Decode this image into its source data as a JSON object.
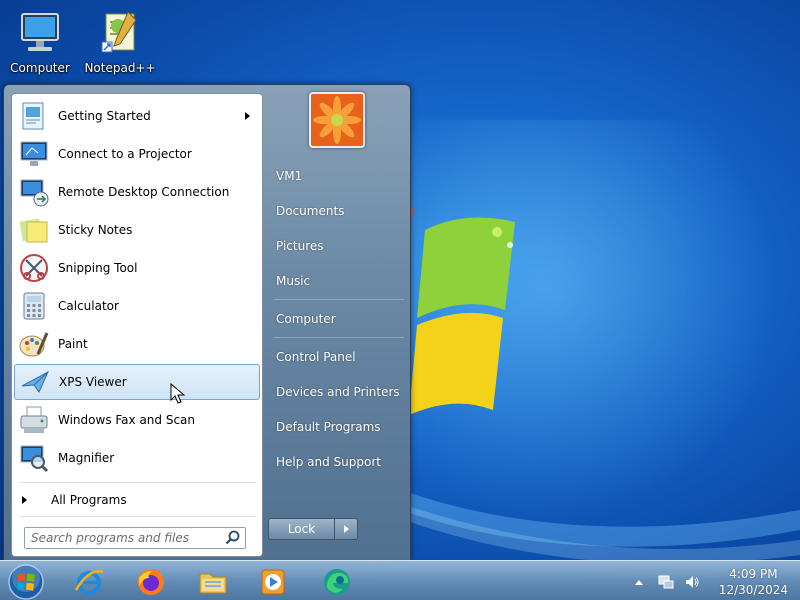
{
  "desktop": {
    "icons": [
      {
        "label": "Computer",
        "icon": "computer-icon"
      },
      {
        "label": "Notepad++",
        "icon": "notepad-plus-plus-icon"
      }
    ]
  },
  "start_menu": {
    "programs": [
      {
        "label": "Getting Started",
        "icon": "getting-started-icon",
        "has_submenu": true
      },
      {
        "label": "Connect to a Projector",
        "icon": "projector-icon"
      },
      {
        "label": "Remote Desktop Connection",
        "icon": "remote-desktop-icon"
      },
      {
        "label": "Sticky Notes",
        "icon": "sticky-notes-icon"
      },
      {
        "label": "Snipping Tool",
        "icon": "snipping-tool-icon"
      },
      {
        "label": "Calculator",
        "icon": "calculator-icon"
      },
      {
        "label": "Paint",
        "icon": "paint-icon"
      },
      {
        "label": "XPS Viewer",
        "icon": "xps-viewer-icon",
        "highlighted": true
      },
      {
        "label": "Windows Fax and Scan",
        "icon": "fax-scan-icon"
      },
      {
        "label": "Magnifier",
        "icon": "magnifier-icon"
      }
    ],
    "all_programs_label": "All Programs",
    "search_placeholder": "Search programs and files",
    "right_items": [
      {
        "label": "VM1"
      },
      {
        "label": "Documents"
      },
      {
        "label": "Pictures"
      },
      {
        "label": "Music"
      },
      {
        "label": "Computer"
      },
      {
        "label": "Control Panel"
      },
      {
        "label": "Devices and Printers"
      },
      {
        "label": "Default Programs"
      },
      {
        "label": "Help and Support"
      }
    ],
    "shutdown_label": "Lock"
  },
  "taskbar": {
    "pinned": [
      {
        "icon": "internet-explorer-icon"
      },
      {
        "icon": "firefox-icon"
      },
      {
        "icon": "file-explorer-icon"
      },
      {
        "icon": "media-player-icon"
      },
      {
        "icon": "edge-icon"
      }
    ],
    "tray": {
      "time": "4:09 PM",
      "date": "12/30/2024"
    }
  },
  "colors": {
    "wallpaper": "#1565c8",
    "highlight_border": "#7da2ce",
    "right_pane": "#6c8aa6"
  }
}
